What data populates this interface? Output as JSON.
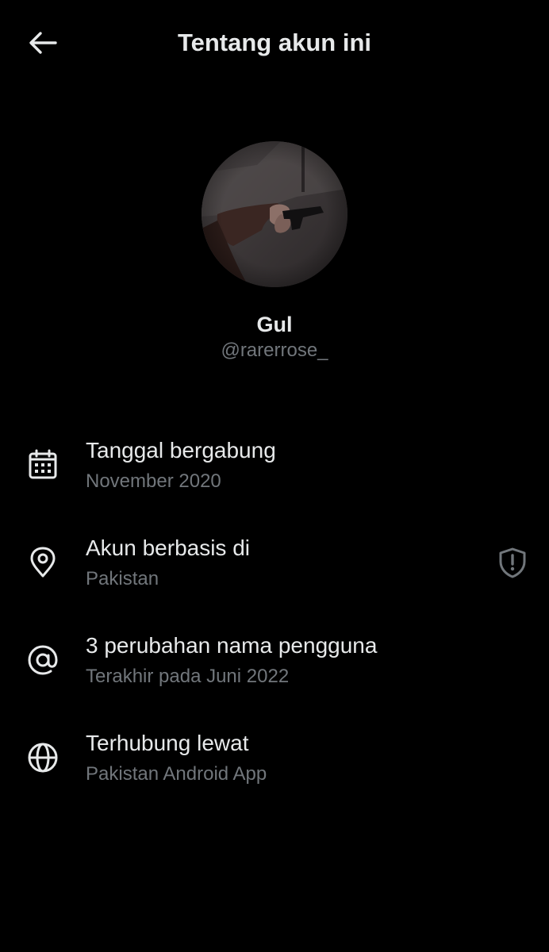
{
  "header": {
    "title": "Tentang akun ini",
    "back_icon": "arrow-left-icon"
  },
  "profile": {
    "name": "Gul",
    "handle": "@rarerrose_"
  },
  "info": [
    {
      "icon": "calendar-icon",
      "title": "Tanggal bergabung",
      "subtitle": "November 2020"
    },
    {
      "icon": "location-pin-icon",
      "title": "Akun berbasis di",
      "subtitle": "Pakistan",
      "trailing_icon": "shield-alert-icon"
    },
    {
      "icon": "at-sign-icon",
      "title": "3 perubahan nama pengguna",
      "subtitle": "Terakhir pada Juni 2022"
    },
    {
      "icon": "globe-icon",
      "title": "Terhubung lewat",
      "subtitle": "Pakistan Android App"
    }
  ],
  "colors": {
    "background": "#000000",
    "primary_text": "#e7e9ea",
    "secondary_text": "#71767b"
  }
}
